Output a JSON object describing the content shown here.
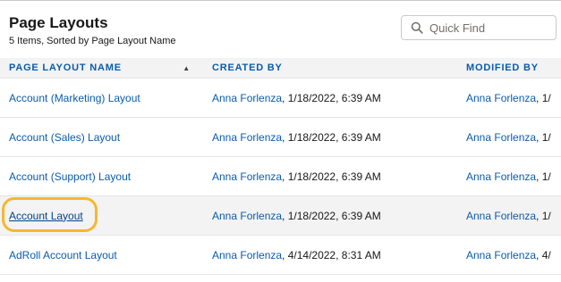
{
  "header": {
    "title": "Page Layouts",
    "subtitle": "5 Items, Sorted by Page Layout Name"
  },
  "search": {
    "placeholder": "Quick Find",
    "icon": "search-icon"
  },
  "table": {
    "columns": [
      {
        "label": "PAGE LAYOUT NAME",
        "sorted": "ascending"
      },
      {
        "label": "CREATED BY"
      },
      {
        "label": "MODIFIED BY"
      }
    ],
    "sort_indicator": "▲",
    "rows": [
      {
        "name": "Account (Marketing) Layout",
        "created_by": "Anna Forlenza",
        "created_date": ", 1/18/2022, 6:39 AM",
        "modified_by": "Anna Forlenza",
        "modified_date": ", 1/"
      },
      {
        "name": "Account (Sales) Layout",
        "created_by": "Anna Forlenza",
        "created_date": ", 1/18/2022, 6:39 AM",
        "modified_by": "Anna Forlenza",
        "modified_date": ", 1/"
      },
      {
        "name": "Account (Support) Layout",
        "created_by": "Anna Forlenza",
        "created_date": ", 1/18/2022, 6:39 AM",
        "modified_by": "Anna Forlenza",
        "modified_date": ", 1/"
      },
      {
        "name": "Account Layout",
        "created_by": "Anna Forlenza",
        "created_date": ", 1/18/2022, 6:39 AM",
        "modified_by": "Anna Forlenza",
        "modified_date": ", 1/"
      },
      {
        "name": "AdRoll Account Layout",
        "created_by": "Anna Forlenza",
        "created_date": ", 4/14/2022, 8:31 AM",
        "modified_by": "Anna Forlenza",
        "modified_date": ", 4/"
      }
    ]
  },
  "colors": {
    "link": "#0b5cab",
    "highlight_ring": "#f5b82e",
    "header_row_bg": "#f3f3f3"
  }
}
